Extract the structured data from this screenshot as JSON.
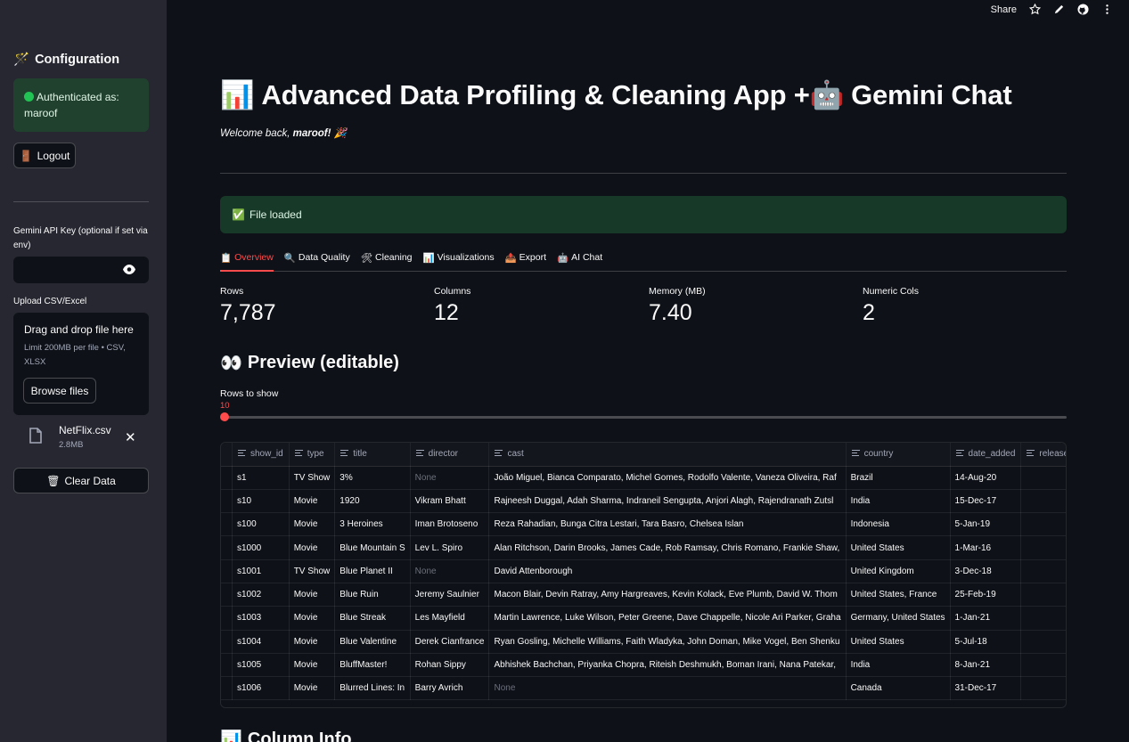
{
  "sidebar": {
    "title": "Configuration",
    "auth_text": "Authenticated as: maroof",
    "logout_label": "Logout",
    "api_key_label": "Gemini API Key (optional if set via env)",
    "upload_label": "Upload CSV/Excel",
    "dropzone": {
      "title": "Drag and drop file here",
      "limit": "Limit 200MB per file • CSV, XLSX",
      "browse_label": "Browse files"
    },
    "file": {
      "name": "NetFlix.csv",
      "size": "2.8MB"
    },
    "clear_label": "Clear Data"
  },
  "toolbar": {
    "share_label": "Share"
  },
  "main": {
    "title": "Advanced Data Profiling & Cleaning App + ",
    "title_suffix": "Gemini Chat",
    "welcome_prefix": "Welcome back, ",
    "welcome_user": "maroof!",
    "success_text": "File loaded",
    "tabs": [
      {
        "icon": "📋",
        "label": "Overview"
      },
      {
        "icon": "🔍",
        "label": "Data Quality"
      },
      {
        "icon": "🛠",
        "label": "Cleaning"
      },
      {
        "icon": "📊",
        "label": "Visualizations"
      },
      {
        "icon": "📤",
        "label": "Export"
      },
      {
        "icon": "🤖",
        "label": "AI Chat"
      }
    ],
    "metrics": [
      {
        "label": "Rows",
        "value": "7,787"
      },
      {
        "label": "Columns",
        "value": "12"
      },
      {
        "label": "Memory (MB)",
        "value": "7.40"
      },
      {
        "label": "Numeric Cols",
        "value": "2"
      }
    ],
    "preview_title": "Preview (editable)",
    "slider": {
      "label": "Rows to show",
      "value": "10",
      "fraction": 0.0
    },
    "next_section": "Column Info"
  },
  "table": {
    "columns": [
      "show_id",
      "type",
      "title",
      "director",
      "cast",
      "country",
      "date_added",
      "release_y"
    ],
    "rows": [
      [
        "s1",
        "TV Show",
        "3%",
        "None",
        "João Miguel, Bianca Comparato, Michel Gomes, Rodolfo Valente, Vaneza Oliveira, Raf",
        "Brazil",
        "14-Aug-20",
        ""
      ],
      [
        "s10",
        "Movie",
        "1920",
        "Vikram Bhatt",
        "Rajneesh Duggal, Adah Sharma, Indraneil Sengupta, Anjori Alagh, Rajendranath Zutsl",
        "India",
        "15-Dec-17",
        ""
      ],
      [
        "s100",
        "Movie",
        "3 Heroines",
        "Iman Brotoseno",
        "Reza Rahadian, Bunga Citra Lestari, Tara Basro, Chelsea Islan",
        "Indonesia",
        "5-Jan-19",
        ""
      ],
      [
        "s1000",
        "Movie",
        "Blue Mountain S",
        "Lev L. Spiro",
        "Alan Ritchson, Darin Brooks, James Cade, Rob Ramsay, Chris Romano, Frankie Shaw,",
        "United States",
        "1-Mar-16",
        ""
      ],
      [
        "s1001",
        "TV Show",
        "Blue Planet II",
        "None",
        "David Attenborough",
        "United Kingdom",
        "3-Dec-18",
        ""
      ],
      [
        "s1002",
        "Movie",
        "Blue Ruin",
        "Jeremy Saulnier",
        "Macon Blair, Devin Ratray, Amy Hargreaves, Kevin Kolack, Eve Plumb, David W. Thom",
        "United States, France",
        "25-Feb-19",
        ""
      ],
      [
        "s1003",
        "Movie",
        "Blue Streak",
        "Les Mayfield",
        "Martin Lawrence, Luke Wilson, Peter Greene, Dave Chappelle, Nicole Ari Parker, Graha",
        "Germany, United States",
        "1-Jan-21",
        ""
      ],
      [
        "s1004",
        "Movie",
        "Blue Valentine",
        "Derek Cianfrance",
        "Ryan Gosling, Michelle Williams, Faith Wladyka, John Doman, Mike Vogel, Ben Shenku",
        "United States",
        "5-Jul-18",
        ""
      ],
      [
        "s1005",
        "Movie",
        "BluffMaster!",
        "Rohan Sippy",
        "Abhishek Bachchan, Priyanka Chopra, Riteish Deshmukh, Boman Irani, Nana Patekar,",
        "India",
        "8-Jan-21",
        ""
      ],
      [
        "s1006",
        "Movie",
        "Blurred Lines: In",
        "Barry Avrich",
        "None",
        "Canada",
        "31-Dec-17",
        ""
      ]
    ]
  },
  "colors": {
    "accent": "#ff4b4b",
    "success_bg": "#173928",
    "sidebar_bg": "#262730",
    "page_bg": "#0e1117"
  }
}
